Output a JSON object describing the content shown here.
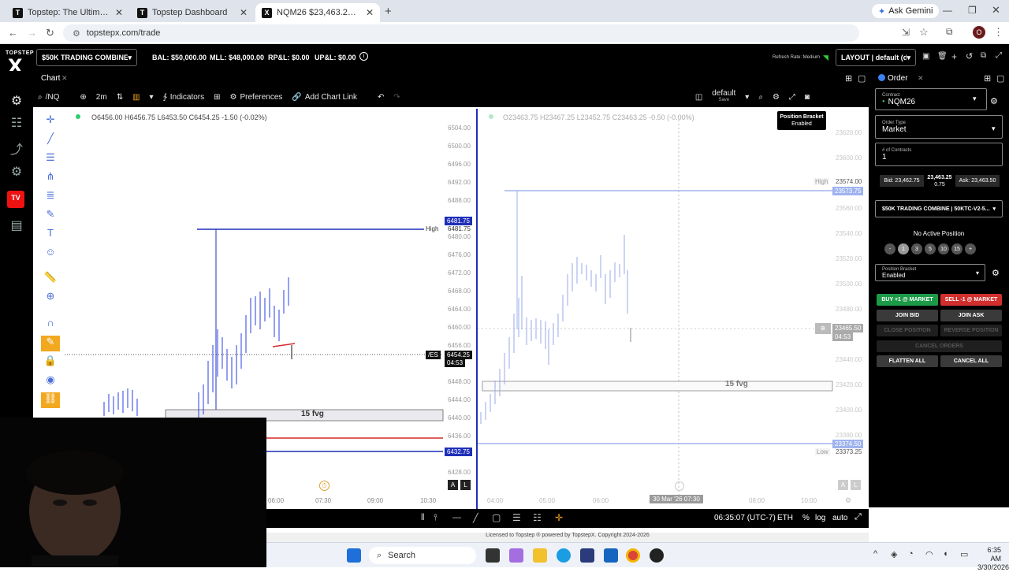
{
  "browser": {
    "tabs": [
      {
        "label": "Topstep: The Ultimate Trading",
        "icon": "T",
        "active": false
      },
      {
        "label": "Topstep Dashboard",
        "icon": "T",
        "active": false
      },
      {
        "label": "NQM26 $23,463.25 ▲ +0.58%",
        "icon": "X",
        "active": true
      }
    ],
    "new_tab": "+",
    "gemini": "Ask Gemini",
    "url": "topstepx.com/trade",
    "profile": "O"
  },
  "app": {
    "logo_top": "TOPSTEP",
    "logo_x": "X",
    "account": "$50K TRADING COMBINE | 5...",
    "bal": "BAL: $50,000.00",
    "mll": "MLL: $48,000.00",
    "rpl": "RP&L: $0.00",
    "upl": "UP&L: $0.00",
    "refresh": "Refresh Rate: Medium",
    "layout": "LAYOUT | default (draft)"
  },
  "chart": {
    "tab": "Chart",
    "symbol": "/NQ",
    "interval": "2m",
    "indicators": "Indicators",
    "preferences": "Preferences",
    "add_link": "Add Chart Link",
    "template": "default",
    "template_sub": "Save",
    "left": {
      "ohlc": "O6456.00  H6456.75  L6453.50  C6454.25  -1.50  (-0.02%)",
      "yticks": [
        "6504.00",
        "6500.00",
        "6496.00",
        "6492.00",
        "6488.00",
        "6484.00",
        "6480.00",
        "6476.00",
        "6472.00",
        "6468.00",
        "6464.00",
        "6460.00",
        "6456.00",
        "6452.00",
        "6448.00",
        "6444.00",
        "6440.00",
        "6436.00",
        "6432.00",
        "6428.00"
      ],
      "high_tag": "6481.75",
      "high_label": "High",
      "high_label_price": "6481.75",
      "cur_sym": "/ES",
      "cur_price": "6454.25",
      "cur_time": "04:53",
      "low_tag": "6432.75",
      "fvg": "15 fvg",
      "xticks": [
        "06:00",
        "07:30",
        "09:00",
        "10:30"
      ],
      "a_btn": "A",
      "l_btn": "L"
    },
    "right": {
      "ohlc": "O23463.75  H23467.25  L23452.75  C23463.25  -0.50  (-0.00%)",
      "bracket_title": "Position Bracket",
      "bracket_status": "Enabled",
      "yticks": [
        "23620.00",
        "23600.00",
        "23580.00",
        "23560.00",
        "23540.00",
        "23520.00",
        "23500.00",
        "23480.00",
        "23460.00",
        "23440.00",
        "23420.00",
        "23400.00",
        "23380.00"
      ],
      "high_label": "High",
      "high_price": "23574.00",
      "high_tag": "23573.75",
      "cur_price": "23465.50",
      "cur_time": "04:53",
      "fvg": "15 fvg",
      "low_tag": "23374.50",
      "low_label": "Low",
      "low_price": "23373.25",
      "xticks": [
        "04:00",
        "05:00",
        "06:00",
        "08:00",
        "10:00"
      ],
      "crosshair_date": "30 Mar '26   07:30",
      "a_btn": "A",
      "l_btn": "L"
    },
    "bottom": {
      "time": "06:35:07 (UTC-7)",
      "session": "ETH",
      "pct": "%",
      "log": "log",
      "auto": "auto"
    },
    "license": "Licensed to Topstep ® powered by TopstepX. Copyright 2024-2026"
  },
  "order": {
    "title": "Order",
    "contract_label": "Contract",
    "contract": "NQM26",
    "ordertype_label": "Order Type",
    "ordertype": "Market",
    "contracts_label": "# of Contracts",
    "contracts": "1",
    "bid": "Bid: 23,462.75",
    "mid": "23,463.25",
    "spread": "0.75",
    "ask": "Ask: 23,463.50",
    "account": "$50K TRADING COMBINE | 50KTC-V2-5...",
    "position": "No Active Position",
    "quick_qty": [
      "-",
      "1",
      "3",
      "5",
      "10",
      "15",
      "+"
    ],
    "bracket_label": "Position Bracket",
    "bracket_value": "Enabled",
    "buy": "BUY +1 @ MARKET",
    "sell": "SELL -1 @ MARKET",
    "join_bid": "JOIN BID",
    "join_ask": "JOIN ASK",
    "close_pos": "CLOSE POSITION",
    "reverse_pos": "REVERSE POSITION",
    "cancel_orders": "CANCEL ORDERS",
    "flatten": "FLATTEN ALL",
    "cancel_all": "CANCEL ALL"
  },
  "taskbar": {
    "search": "Search",
    "time": "6:35 AM",
    "date": "3/30/2026"
  },
  "colors": {
    "blue_line": "#1f2fb8",
    "red_line": "#d42a2a",
    "buy": "#1d9a48",
    "sell": "#d22e2e"
  }
}
